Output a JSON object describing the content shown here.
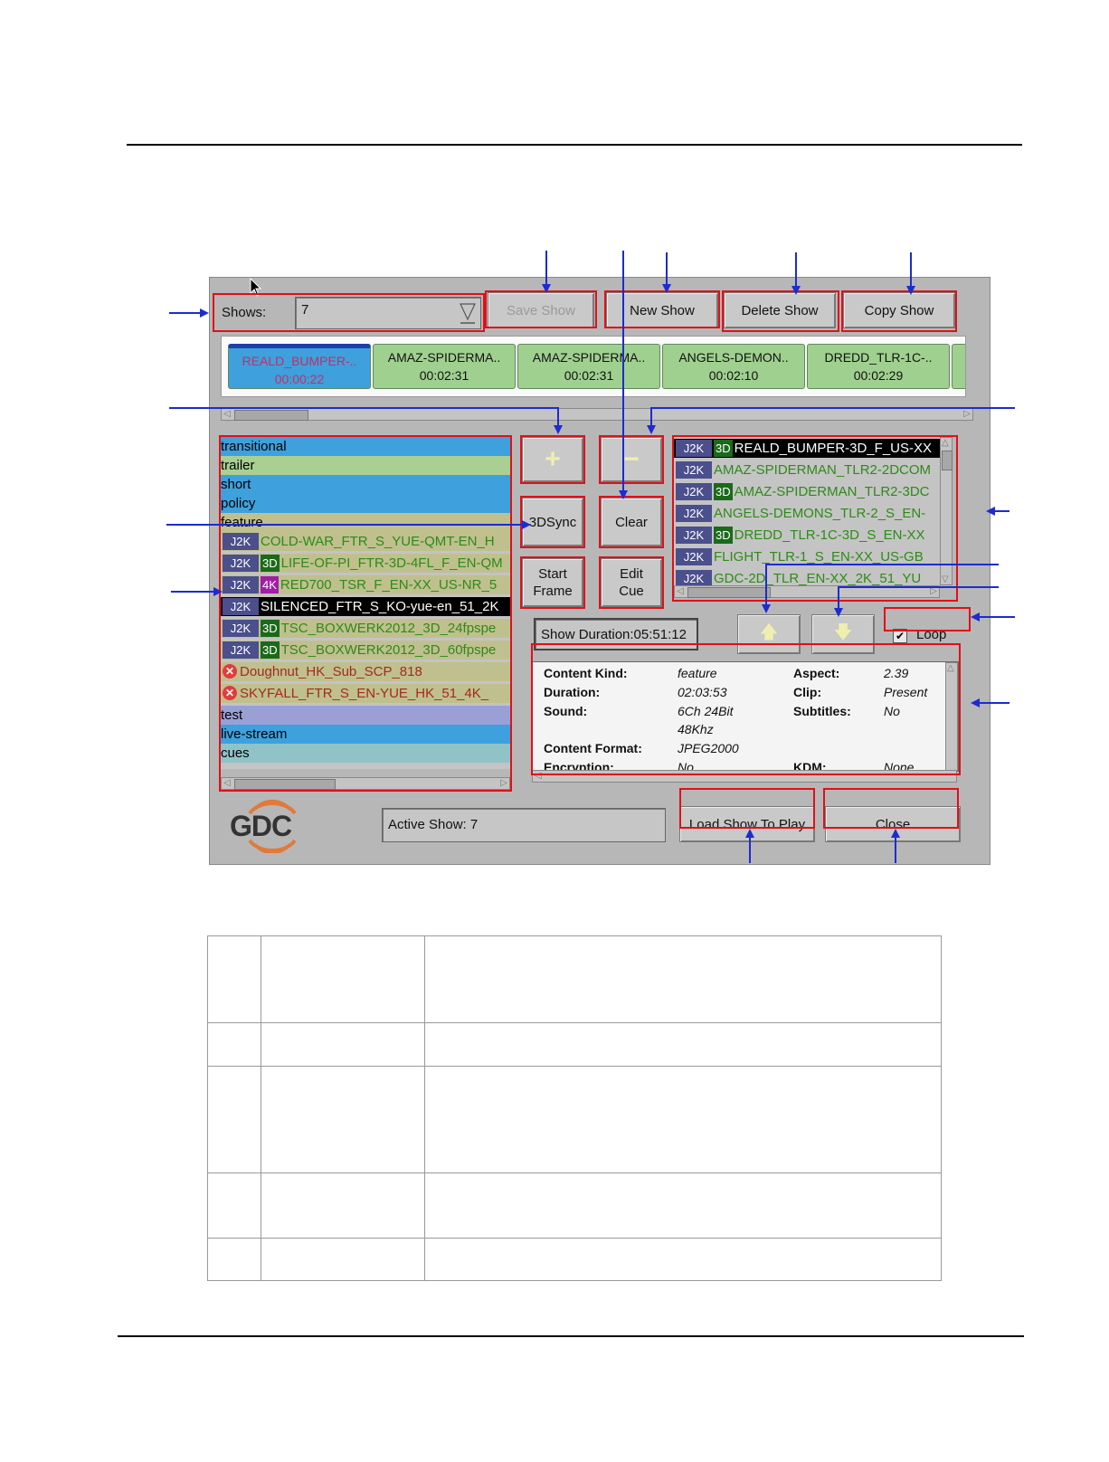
{
  "app": {
    "shows_label": "Shows:",
    "shows_value": "7",
    "buttons": {
      "save_show": "Save Show",
      "new_show": "New Show",
      "delete_show": "Delete Show",
      "copy_show": "Copy Show",
      "add": "+",
      "remove": "−",
      "sync3d": "3DSync",
      "clear": "Clear",
      "start_frame_1": "Start",
      "start_frame_2": "Frame",
      "edit_cue_1": "Edit",
      "edit_cue_2": "Cue",
      "move_up": "🡅",
      "move_down": "🡇",
      "load_show": "Load Show To Play",
      "close": "Close"
    },
    "timeline": [
      {
        "name": "REALD_BUMPER-..",
        "time": "00:00:22",
        "selected": true
      },
      {
        "name": "AMAZ-SPIDERMA..",
        "time": "00:02:31"
      },
      {
        "name": "AMAZ-SPIDERMA..",
        "time": "00:02:31"
      },
      {
        "name": "ANGELS-DEMON..",
        "time": "00:02:10"
      },
      {
        "name": "DREDD_TLR-1C-..",
        "time": "00:02:29"
      }
    ],
    "categories": {
      "transitional": "transitional",
      "trailer": "trailer",
      "short": "short",
      "policy": "policy",
      "feature": "feature",
      "test": "test",
      "live_stream": "live-stream",
      "cues": "cues"
    },
    "feature_items": [
      {
        "fmt": "J2K",
        "flag": "",
        "name": "COLD-WAR_FTR_S_YUE-QMT-EN_H"
      },
      {
        "fmt": "J2K",
        "flag": "3D",
        "name": "LIFE-OF-PI_FTR-3D-4FL_F_EN-QM"
      },
      {
        "fmt": "J2K",
        "flag": "4K",
        "name": "RED700_TSR_F_EN-XX_US-NR_5"
      },
      {
        "fmt": "J2K",
        "flag": "",
        "name": "SILENCED_FTR_S_KO-yue-en_51_2K"
      },
      {
        "fmt": "J2K",
        "flag": "3D",
        "name": "TSC_BOXWERK2012_3D_24fpspe"
      },
      {
        "fmt": "J2K",
        "flag": "3D",
        "name": "TSC_BOXWERK2012_3D_60fpspe"
      }
    ],
    "error_items": [
      "Doughnut_HK_Sub_SCP_818",
      "SKYFALL_FTR_S_EN-YUE_HK_51_4K_"
    ],
    "show_items": [
      {
        "fmt": "J2K",
        "flag": "3D",
        "name": "REALD_BUMPER-3D_F_US-XX"
      },
      {
        "fmt": "J2K",
        "flag": "",
        "name": "AMAZ-SPIDERMAN_TLR2-2DCOM"
      },
      {
        "fmt": "J2K",
        "flag": "3D",
        "name": "AMAZ-SPIDERMAN_TLR2-3DC"
      },
      {
        "fmt": "J2K",
        "flag": "",
        "name": "ANGELS-DEMONS_TLR-2_S_EN-"
      },
      {
        "fmt": "J2K",
        "flag": "3D",
        "name": "DREDD_TLR-1C-3D_S_EN-XX"
      },
      {
        "fmt": "J2K",
        "flag": "",
        "name": "FLIGHT_TLR-1_S_EN-XX_US-GB"
      },
      {
        "fmt": "J2K",
        "flag": "",
        "name": "GDC-2D_TLR_EN-XX_2K_51_YU"
      }
    ],
    "show_duration": "Show Duration:05:51:12",
    "loop_label": "Loop",
    "loop_checked": "✔",
    "info": {
      "content_kind_k": "Content Kind:",
      "content_kind_v": "feature",
      "duration_k": "Duration:",
      "duration_v": "02:03:53",
      "sound_k": "Sound:",
      "sound_v1": "6Ch 24Bit",
      "sound_v2": "48Khz",
      "content_format_k": "Content Format:",
      "content_format_v": "JPEG2000",
      "encryption_k": "Encryption:",
      "encryption_v": "No",
      "aspect_k": "Aspect:",
      "aspect_v": "2.39",
      "clip_k": "Clip:",
      "clip_v": "Present",
      "subtitles_k": "Subtitles:",
      "subtitles_v": "No",
      "kdm_k": "KDM:",
      "kdm_v": "None"
    },
    "active_show": "Active Show: 7",
    "logo": "GDC"
  },
  "colors": {
    "red_annotation": "#e0101a",
    "arrow_blue": "#1d2bd0",
    "category_blue": "#3ea0dc",
    "category_green": "#a9cf93",
    "category_khaki": "#bfc08e",
    "category_purple": "#9aa0d6",
    "category_teal": "#8fc3c8"
  }
}
